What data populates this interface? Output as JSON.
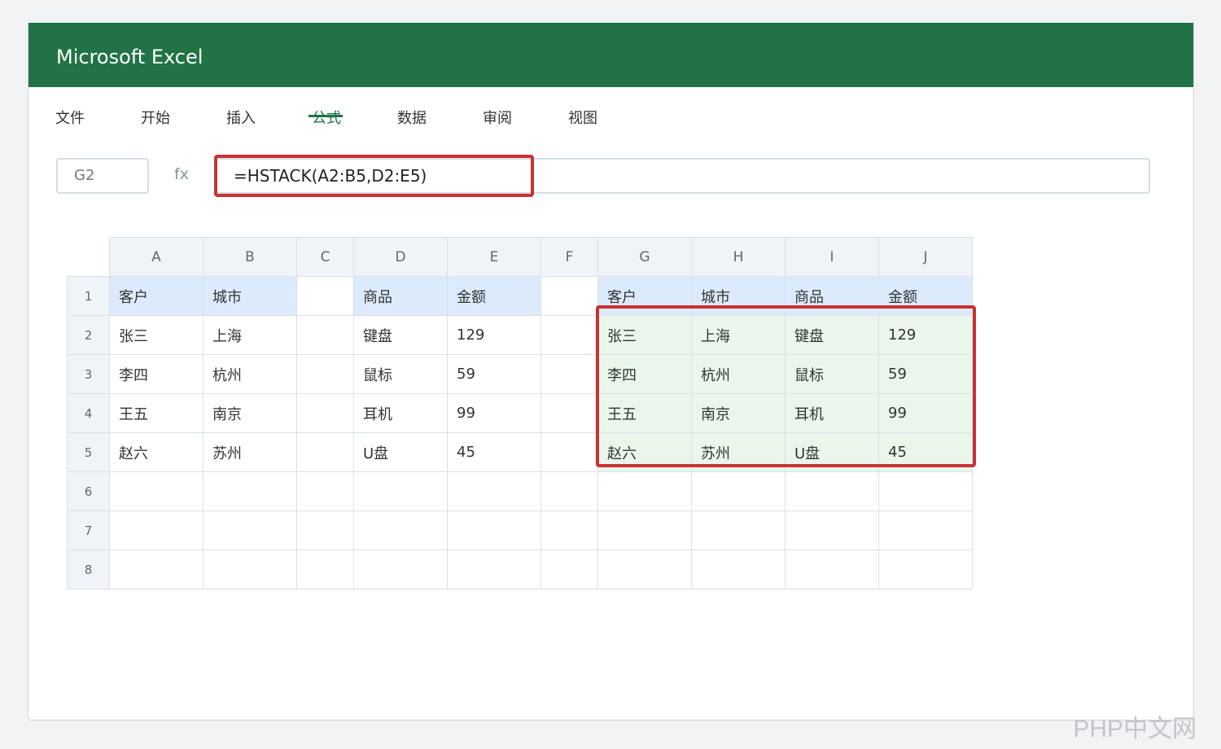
{
  "app": {
    "title": "Microsoft Excel"
  },
  "menu": [
    {
      "label": "文件",
      "active": false
    },
    {
      "label": "开始",
      "active": false
    },
    {
      "label": "插入",
      "active": false
    },
    {
      "label": "公式",
      "active": true
    },
    {
      "label": "数据",
      "active": false
    },
    {
      "label": "审阅",
      "active": false
    },
    {
      "label": "视图",
      "active": false
    }
  ],
  "formula_bar": {
    "cell_ref": "G2",
    "fx_label": "fx",
    "formula": "=HSTACK(A2:B5,D2:E5)"
  },
  "sheet": {
    "columns": [
      "A",
      "B",
      "C",
      "D",
      "E",
      "F",
      "G",
      "H",
      "I",
      "J"
    ],
    "rows": [
      {
        "num": "1",
        "cells": [
          "客户",
          "城市",
          "",
          "商品",
          "金额",
          "",
          "客户",
          "城市",
          "商品",
          "金额"
        ]
      },
      {
        "num": "2",
        "cells": [
          "张三",
          "上海",
          "",
          "键盘",
          "129",
          "",
          "张三",
          "上海",
          "键盘",
          "129"
        ]
      },
      {
        "num": "3",
        "cells": [
          "李四",
          "杭州",
          "",
          "鼠标",
          "59",
          "",
          "李四",
          "杭州",
          "鼠标",
          "59"
        ]
      },
      {
        "num": "4",
        "cells": [
          "王五",
          "南京",
          "",
          "耳机",
          "99",
          "",
          "王五",
          "南京",
          "耳机",
          "99"
        ]
      },
      {
        "num": "5",
        "cells": [
          "赵六",
          "苏州",
          "",
          "U盘",
          "45",
          "",
          "赵六",
          "苏州",
          "U盘",
          "45"
        ]
      },
      {
        "num": "6",
        "cells": [
          "",
          "",
          "",
          "",
          "",
          "",
          "",
          "",
          "",
          ""
        ]
      },
      {
        "num": "7",
        "cells": [
          "",
          "",
          "",
          "",
          "",
          "",
          "",
          "",
          "",
          ""
        ]
      },
      {
        "num": "8",
        "cells": [
          "",
          "",
          "",
          "",
          "",
          "",
          "",
          "",
          "",
          ""
        ]
      }
    ]
  },
  "colors": {
    "brand": "#217346",
    "highlight": "#c83232",
    "header_fill": "#dcebfb",
    "result_fill": "#eaf6ec"
  },
  "watermark": "PHP中文网"
}
